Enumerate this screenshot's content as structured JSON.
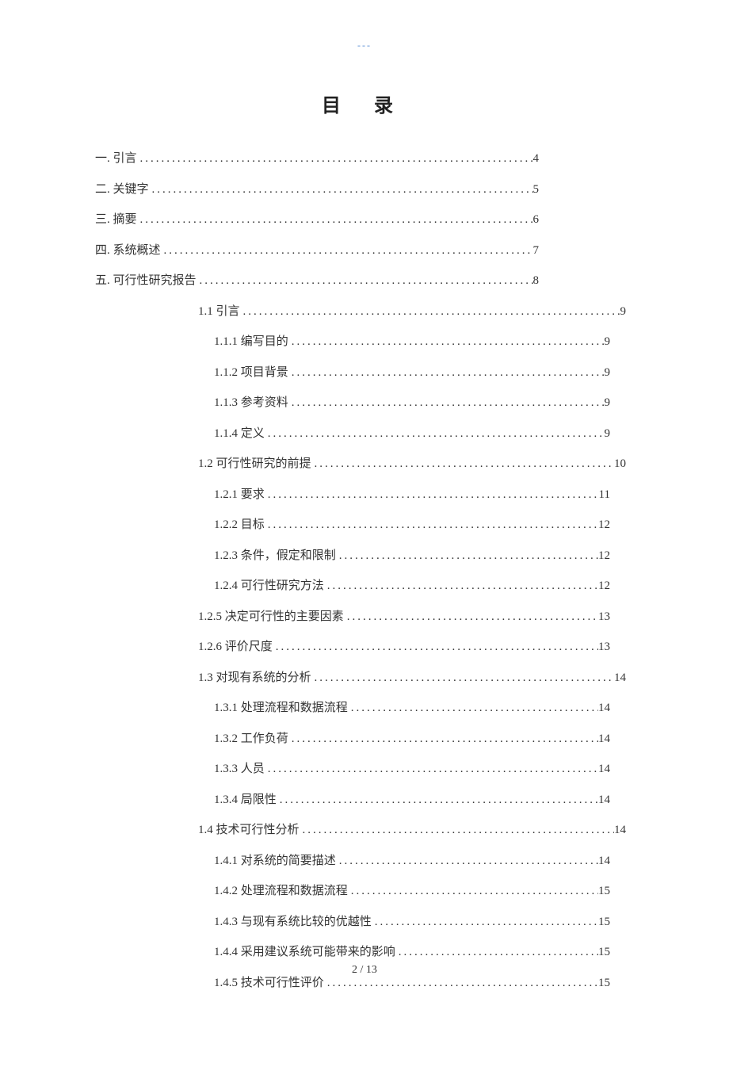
{
  "header_marker": "---",
  "title": "目  录",
  "toc": [
    {
      "level": 0,
      "label": "一. 引言",
      "page": "4"
    },
    {
      "level": 0,
      "label": "二. 关键字",
      "page": "5"
    },
    {
      "level": 0,
      "label": "三. 摘要",
      "page": "6"
    },
    {
      "level": 0,
      "label": "四.  系统概述",
      "page": "7"
    },
    {
      "level": 0,
      "label": "五.  可行性研究报告",
      "page": "8"
    },
    {
      "level": 1,
      "label": "1.1 引言",
      "page": "9"
    },
    {
      "level": 2,
      "label": "1.1.1 编写目的",
      "page": "9"
    },
    {
      "level": 2,
      "label": "1.1.2 项目背景",
      "page": "9"
    },
    {
      "level": 2,
      "label": "1.1.3 参考资料",
      "page": "9"
    },
    {
      "level": 2,
      "label": "1.1.4 定义",
      "page": "9"
    },
    {
      "level": 1,
      "label": "1.2 可行性研究的前提",
      "page": "10"
    },
    {
      "level": 2,
      "label": "1.2.1 要求",
      "page": "11"
    },
    {
      "level": 2,
      "label": "1.2.2 目标",
      "page": "12"
    },
    {
      "level": 2,
      "label": "1.2.3 条件，假定和限制",
      "page": "12"
    },
    {
      "level": 2,
      "label": "1.2.4 可行性研究方法",
      "page": "12"
    },
    {
      "level": 3,
      "label": "1.2.5 决定可行性的主要因素",
      "page": "13"
    },
    {
      "level": 3,
      "label": "1.2.6 评价尺度",
      "page": "13"
    },
    {
      "level": 1,
      "label": "1.3 对现有系统的分析",
      "page": "14"
    },
    {
      "level": 2,
      "label": "1.3.1 处理流程和数据流程",
      "page": "14"
    },
    {
      "level": 2,
      "label": "1.3.2 工作负荷",
      "page": "14"
    },
    {
      "level": 2,
      "label": "1.3.3 人员",
      "page": "14"
    },
    {
      "level": 2,
      "label": "1.3.4 局限性",
      "page": "14"
    },
    {
      "level": 1,
      "label": "1.4 技术可行性分析",
      "page": "14"
    },
    {
      "level": 2,
      "label": "1.4.1 对系统的简要描述",
      "page": "14"
    },
    {
      "level": 2,
      "label": "1.4.2 处理流程和数据流程",
      "page": "15"
    },
    {
      "level": 2,
      "label": "1.4.3 与现有系统比较的优越性",
      "page": "15"
    },
    {
      "level": 2,
      "label": "1.4.4 采用建议系统可能带来的影响",
      "page": "15"
    },
    {
      "level": 2,
      "label": "1.4.5 技术可行性评价",
      "page": "15"
    }
  ],
  "footer": "2  / 13"
}
